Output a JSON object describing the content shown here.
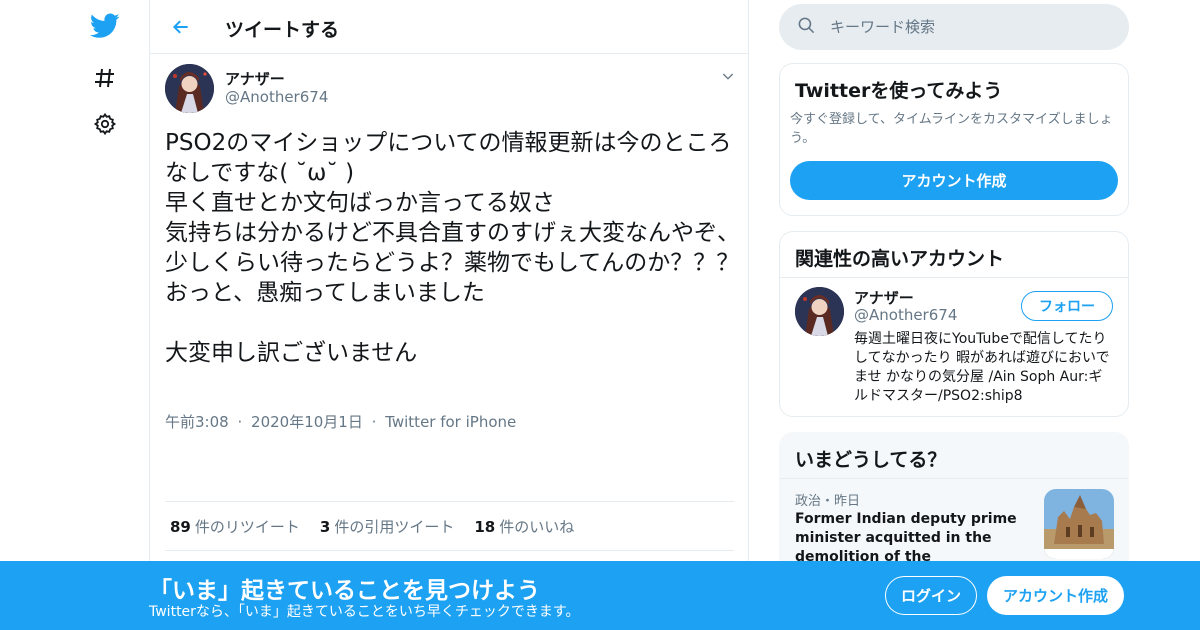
{
  "colors": {
    "accent": "#1da1f2",
    "secondary_text": "#657786",
    "border": "#e6ecf0",
    "background": "#ffffff"
  },
  "nav": {
    "icons": [
      "twitter-logo-icon",
      "hashtag-icon",
      "gear-icon"
    ]
  },
  "header": {
    "title": "ツイートする",
    "back_icon": "back-arrow-icon"
  },
  "tweet": {
    "author_name": "アナザー",
    "author_handle": "@Another674",
    "text": "PSO2のマイショップについての情報更新は今のところなしですな( ˘ω˘ )\n早く直せとか文句ばっか言ってる奴さ\n気持ちは分かるけど不具合直すのすげぇ大変なんやぞ、少しくらい待ったらどうよ？薬物でもしてんのか？？？\nおっと、愚痴ってしまいました\n\n大変申し訳ございません",
    "time": "午前3:08",
    "date": "2020年10月1日",
    "source": "Twitter for iPhone",
    "separator": "·",
    "stats": {
      "retweets_count": "89",
      "retweets_label": "件のリツイート",
      "quotes_count": "3",
      "quotes_label": "件の引用ツイート",
      "likes_count": "18",
      "likes_label": "件のいいね"
    },
    "actions": [
      "reply-icon",
      "retweet-icon",
      "like-icon",
      "share-icon"
    ]
  },
  "search": {
    "placeholder": "キーワード検索"
  },
  "signup_card": {
    "title": "Twitterを使ってみよう",
    "description": "今すぐ登録して、タイムラインをカスタマイズしましょう。",
    "button": "アカウント作成"
  },
  "related_card": {
    "title": "関連性の高いアカウント",
    "name": "アナザー",
    "handle": "@Another674",
    "follow_button": "フォロー",
    "bio": "毎週土曜日夜にYouTubeで配信してたりしてなかったり 暇があれば遊びにおいでませ かなりの気分屋 /Ain Soph Aur:ギルドマスター/PSO2:ship8"
  },
  "trends_card": {
    "title": "いまどうしてる？",
    "meta": "政治・昨日",
    "headline": "Former Indian deputy prime minister acquitted in the demolition of the controversial Babri mosque"
  },
  "banner": {
    "title": "「いま」起きていることを見つけよう",
    "subtitle": "Twitterなら、「いま」起きていることをいち早くチェックできます。",
    "login_button": "ログイン",
    "signup_button": "アカウント作成"
  }
}
